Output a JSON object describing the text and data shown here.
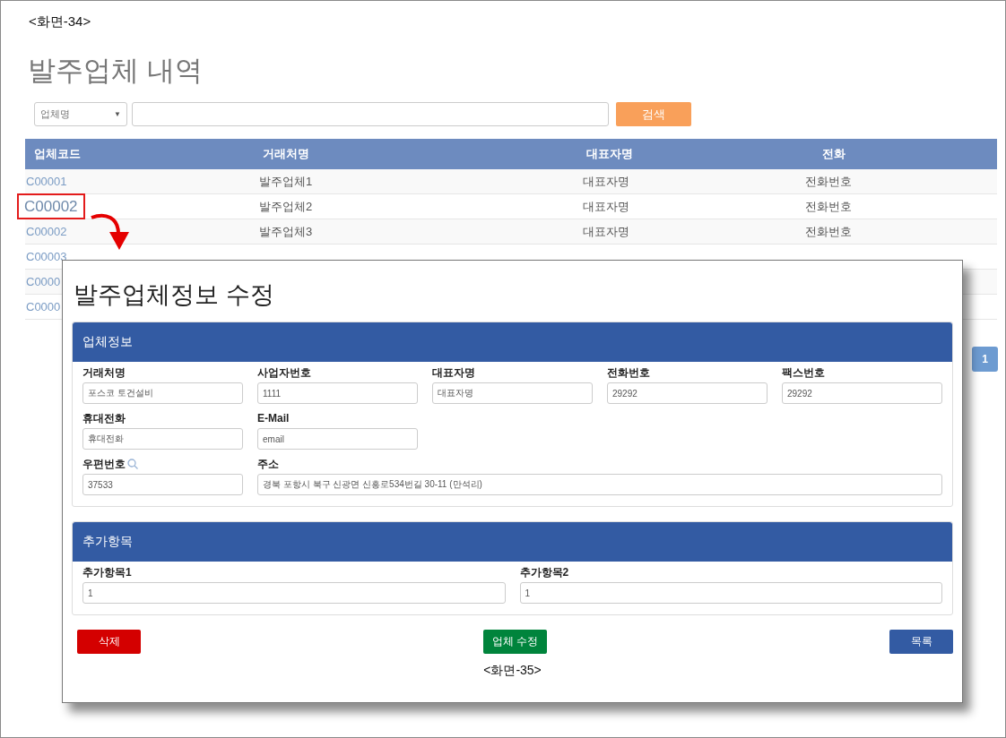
{
  "screen_label": "<화면-34>",
  "title": "발주업체 내역",
  "search": {
    "select": "업체명",
    "select_caret": "▼",
    "button": "검색"
  },
  "table": {
    "columns": [
      "업체코드",
      "거래처명",
      "대표자명",
      "전화"
    ],
    "rows": [
      {
        "code": "C00001",
        "name": "발주업체1",
        "rep": "대표자명",
        "phone": "전화번호",
        "highlighted": false
      },
      {
        "code": "C00002",
        "name": "발주업체2",
        "rep": "대표자명",
        "phone": "전화번호",
        "highlighted": true
      },
      {
        "code": "C00002",
        "name": "발주업체3",
        "rep": "대표자명",
        "phone": "전화번호",
        "highlighted": false
      },
      {
        "code": "C00003",
        "highlighted": false
      },
      {
        "code": "C0000",
        "highlighted": false
      },
      {
        "code": "C0000",
        "highlighted": false
      }
    ]
  },
  "pagination": [
    {
      "label": "1",
      "selected": true
    }
  ],
  "modal": {
    "title": "발주업체정보 수정",
    "panels": [
      {
        "header": "업체정보",
        "rows": [
          [
            {
              "label": "거래처명",
              "value": "포스코 토건설비",
              "kind": "short",
              "has_lookup": false
            },
            {
              "label": "사업자번호",
              "value": "1111",
              "kind": "short",
              "has_lookup": false
            },
            {
              "label": "대표자명",
              "value": "대표자명",
              "kind": "short",
              "has_lookup": false
            },
            {
              "label": "전화번호",
              "value": "29292",
              "kind": "short",
              "has_lookup": false
            },
            {
              "label": "팩스번호",
              "value": "29292",
              "kind": "short",
              "has_lookup": false
            }
          ],
          [
            {
              "label": "휴대전화",
              "value": "휴대전화",
              "kind": "short",
              "has_lookup": false
            },
            {
              "label": "E-Mail",
              "value": "email",
              "kind": "short",
              "has_lookup": false
            }
          ],
          [
            {
              "label": "우편번호",
              "value": "37533",
              "kind": "short",
              "has_lookup": true
            },
            {
              "label": "주소",
              "value": "경북 포항시 북구 신광면 신흥로534번길 30-11 (만석리)",
              "kind": "wide",
              "has_lookup": false
            }
          ]
        ]
      },
      {
        "header": "추가항목",
        "rows": [
          [
            {
              "label": "추가항목1",
              "value": "1",
              "kind": "short",
              "has_lookup": false
            },
            {
              "label": "추가항목2",
              "value": "1",
              "kind": "short",
              "has_lookup": false
            }
          ]
        ]
      }
    ],
    "buttons": [
      {
        "label": "삭제",
        "kind": "delete"
      },
      {
        "label": "업체 수정",
        "kind": "update"
      },
      {
        "label": "목록",
        "kind": "list"
      }
    ],
    "screen_label": "<화면-35>"
  }
}
